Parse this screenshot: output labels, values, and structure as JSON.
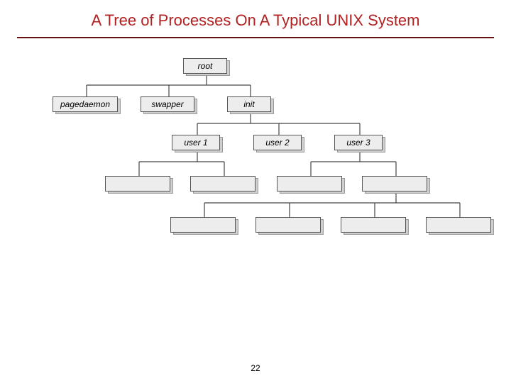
{
  "title": "A Tree of Processes On A Typical UNIX System",
  "page_number": "22",
  "nodes": {
    "root": "root",
    "pagedaemon": "pagedaemon",
    "swapper": "swapper",
    "init": "init",
    "user1": "user 1",
    "user2": "user 2",
    "user3": "user 3",
    "l3a": "",
    "l3b": "",
    "l3c": "",
    "l3d": "",
    "l4a": "",
    "l4b": "",
    "l4c": "",
    "l4d": ""
  },
  "tree_structure": {
    "root": [
      "pagedaemon",
      "swapper",
      "init"
    ],
    "init": [
      "user1",
      "user2",
      "user3"
    ],
    "user1": [
      "l3a",
      "l3b"
    ],
    "user3": [
      "l3c",
      "l3d"
    ],
    "l3d": [
      "l4a",
      "l4b",
      "l4c",
      "l4d"
    ]
  }
}
